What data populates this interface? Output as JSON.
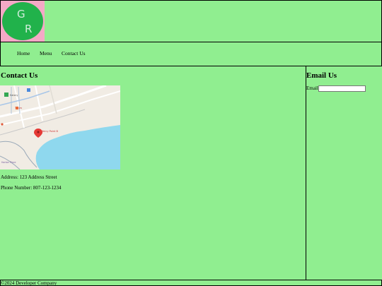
{
  "logo": {
    "letter_top": "G",
    "letter_bottom": "R",
    "colors": {
      "background": "#f4a9c6",
      "circle": "#21b24b",
      "letters": "#cfeeda"
    }
  },
  "nav": {
    "items": [
      {
        "label": "Home"
      },
      {
        "label": "Menu"
      },
      {
        "label": "Contact Us"
      }
    ]
  },
  "main": {
    "title": "Contact Us",
    "map": {
      "icon": "map-pin-icon",
      "labels": [
        "Eatery",
        "Tokyo",
        "Mercy Point B",
        "Harbor Place"
      ]
    },
    "address": "Address: 123 Address Street",
    "phone": "Phone Number: 807-123-1234"
  },
  "aside": {
    "title": "Email Us",
    "email_label": "Email",
    "email_value": "",
    "email_placeholder": ""
  },
  "footer": {
    "text": "©2024 Developer Company"
  },
  "colors": {
    "page_background": "#90ee90",
    "border": "#000000"
  }
}
